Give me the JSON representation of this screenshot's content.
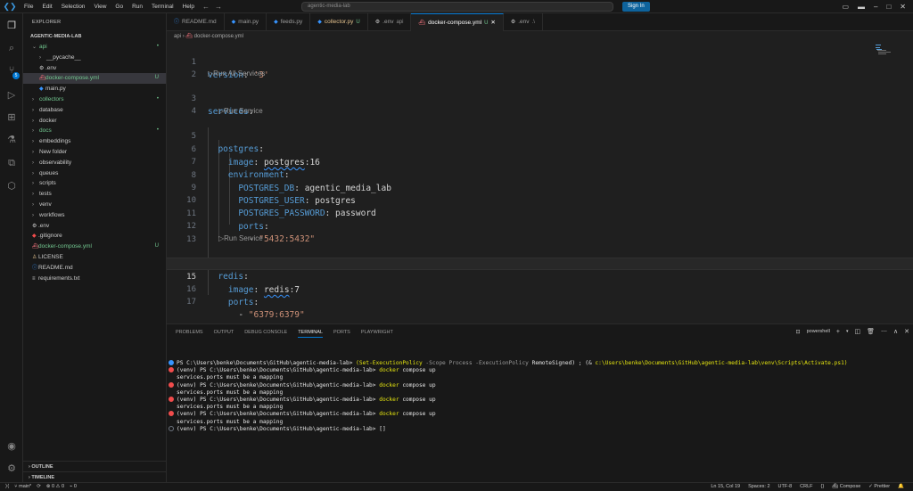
{
  "titlebar": {
    "menu": [
      "File",
      "Edit",
      "Selection",
      "View",
      "Go",
      "Run",
      "Terminal",
      "Help"
    ],
    "search_placeholder": "agentic-media-lab",
    "signin_label": "Sign In"
  },
  "sidebar": {
    "title": "EXPLORER",
    "root": "AGENTIC-MEDIA-LAB",
    "items": [
      {
        "label": "api",
        "depth": 0,
        "kind": "folder-open",
        "color": "#73c991",
        "status": "•"
      },
      {
        "label": "__pycache__",
        "depth": 1,
        "kind": "folder",
        "color": "#cccccc",
        "status": ""
      },
      {
        "label": ".env",
        "depth": 1,
        "kind": "gear",
        "color": "#cccccc",
        "status": ""
      },
      {
        "label": "docker-compose.yml",
        "depth": 1,
        "kind": "docker",
        "color": "#73c991",
        "status": "U",
        "selected": true
      },
      {
        "label": "main.py",
        "depth": 1,
        "kind": "python",
        "color": "#cccccc",
        "status": ""
      },
      {
        "label": "collectors",
        "depth": 0,
        "kind": "folder",
        "color": "#73c991",
        "status": "•"
      },
      {
        "label": "database",
        "depth": 0,
        "kind": "folder",
        "color": "#cccccc",
        "status": ""
      },
      {
        "label": "docker",
        "depth": 0,
        "kind": "folder",
        "color": "#cccccc",
        "status": ""
      },
      {
        "label": "docs",
        "depth": 0,
        "kind": "folder",
        "color": "#73c991",
        "status": "•"
      },
      {
        "label": "embeddings",
        "depth": 0,
        "kind": "folder",
        "color": "#cccccc",
        "status": ""
      },
      {
        "label": "New folder",
        "depth": 0,
        "kind": "folder",
        "color": "#cccccc",
        "status": ""
      },
      {
        "label": "observability",
        "depth": 0,
        "kind": "folder",
        "color": "#cccccc",
        "status": ""
      },
      {
        "label": "queues",
        "depth": 0,
        "kind": "folder",
        "color": "#cccccc",
        "status": ""
      },
      {
        "label": "scripts",
        "depth": 0,
        "kind": "folder",
        "color": "#cccccc",
        "status": ""
      },
      {
        "label": "tests",
        "depth": 0,
        "kind": "folder",
        "color": "#cccccc",
        "status": ""
      },
      {
        "label": "venv",
        "depth": 0,
        "kind": "folder",
        "color": "#cccccc",
        "status": ""
      },
      {
        "label": "workflows",
        "depth": 0,
        "kind": "folder",
        "color": "#cccccc",
        "status": ""
      },
      {
        "label": ".env",
        "depth": 0,
        "kind": "gear",
        "color": "#cccccc",
        "status": ""
      },
      {
        "label": ".gitignore",
        "depth": 0,
        "kind": "git",
        "color": "#cccccc",
        "status": ""
      },
      {
        "label": "docker-compose.yml",
        "depth": 0,
        "kind": "docker",
        "color": "#73c991",
        "status": "U"
      },
      {
        "label": "LICENSE",
        "depth": 0,
        "kind": "license",
        "color": "#cccccc",
        "status": ""
      },
      {
        "label": "README.md",
        "depth": 0,
        "kind": "info",
        "color": "#cccccc",
        "status": ""
      },
      {
        "label": "requirements.txt",
        "depth": 0,
        "kind": "text",
        "color": "#cccccc",
        "status": ""
      }
    ],
    "outline_label": "OUTLINE",
    "timeline_label": "TIMELINE"
  },
  "tabs": [
    {
      "label": "README.md",
      "icon": "info-icon",
      "status": "",
      "color": "#9d9d9d"
    },
    {
      "label": "main.py",
      "icon": "python-icon",
      "status": "",
      "color": "#9d9d9d"
    },
    {
      "label": "feeds.py",
      "icon": "python-icon",
      "status": "",
      "color": "#9d9d9d"
    },
    {
      "label": "collector.py",
      "icon": "python-icon",
      "status": "U",
      "color": "#e2c08d"
    },
    {
      "label": ".env",
      "icon": "gear-icon",
      "status": "api",
      "color": "#9d9d9d"
    },
    {
      "label": "docker-compose.yml",
      "icon": "docker-icon",
      "status": "U",
      "color": "#ffffff",
      "active": true
    },
    {
      "label": ".env",
      "icon": "gear-icon",
      "status": ".\\",
      "color": "#9d9d9d"
    }
  ],
  "breadcrumb": {
    "folder": "api",
    "sep": "›",
    "file": "docker-compose.yml"
  },
  "editor": {
    "codelens": {
      "run_all": "Run All Services",
      "run_service": "Run Service"
    },
    "line_numbers": [
      "1",
      "2",
      "3",
      "4",
      "5",
      "6",
      "7",
      "8",
      "9",
      "10",
      "11",
      "12",
      "13",
      "14",
      "15",
      "16",
      "17"
    ],
    "lines": {
      "l1_key": "version",
      "l1_val": "'3'",
      "l3_key": "services",
      "l5_key": "postgres",
      "l6_key": "image",
      "l6_val": "postgres",
      "l6_tag": ":16",
      "l7_key": "environment",
      "l8_key": "POSTGRES_DB",
      "l8_val": "agentic_media_lab",
      "l9_key": "POSTGRES_USER",
      "l9_val": "postgres",
      "l10_key": "POSTGRES_PASSWORD",
      "l10_val": "password",
      "l11_key": "ports",
      "l12_val": "\"5432:5432\"",
      "l14_key": "redis",
      "l15_key": "image",
      "l15_val": "redis",
      "l15_tag": ":7",
      "l16_key": "ports",
      "l17_val": "\"6379:6379\""
    }
  },
  "panel": {
    "tabs": [
      "PROBLEMS",
      "OUTPUT",
      "DEBUG CONSOLE",
      "TERMINAL",
      "PORTS",
      "PLAYWRIGHT"
    ],
    "active_tab": "TERMINAL",
    "shell_label": "powershell",
    "terminal": {
      "l1_prompt": "PS C:\\Users\\benke\\Documents\\GitHub\\agentic-media-lab> ",
      "l1_cmd": "(Set-ExecutionPolicy",
      "l1_opts": " -Scope Process -ExecutionPolicy ",
      "l1_val": "RemoteSigned) ; (& ",
      "l1_path": "c:\\Users\\benke\\Documents\\GitHub\\agentic-media-lab\\venv\\Scripts\\Activate.ps1)",
      "venv_prompt": "(venv) PS C:\\Users\\benke\\Documents\\GitHub\\agentic-media-lab> ",
      "cmd_docker": "docker",
      "cmd_args": " compose up",
      "error": "services.ports must be a mapping",
      "cursor": "[]"
    }
  },
  "statusbar": {
    "branch": "main*",
    "sync": "⟳",
    "errors": "0",
    "warnings": "0",
    "ports": "0",
    "position": "Ln 15, Col 19",
    "spaces": "Spaces: 2",
    "encoding": "UTF-8",
    "eol": "CRLF",
    "braces": "{}",
    "compose": "Compose",
    "prettier": "Prettier"
  },
  "colors": {
    "accent": "#0078d4",
    "git_added": "#73c991",
    "keyword": "#569cd6",
    "string": "#ce9178"
  }
}
